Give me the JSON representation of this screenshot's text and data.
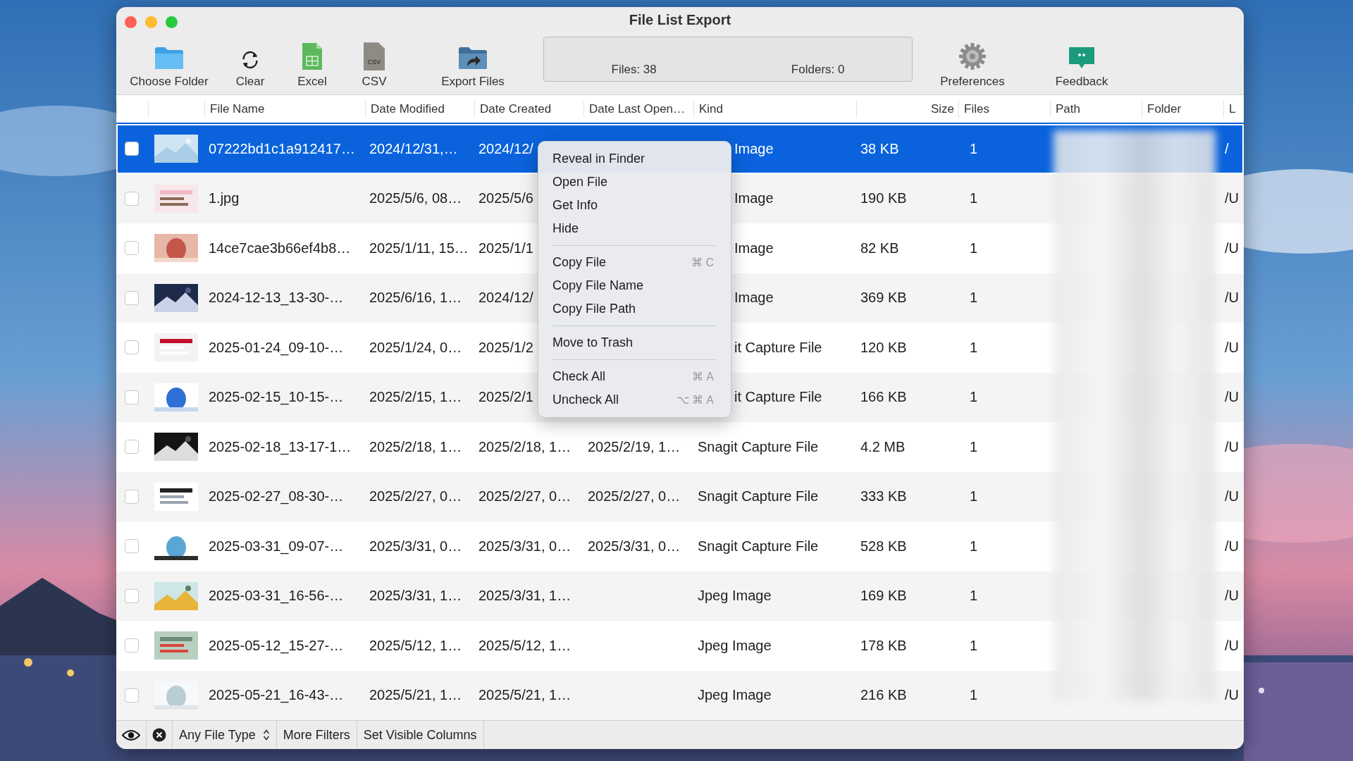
{
  "window": {
    "title": "File List Export"
  },
  "toolbar": [
    {
      "kind": "folder",
      "label": "Choose Folder"
    },
    {
      "kind": "refresh",
      "label": "Clear"
    },
    {
      "kind": "excel",
      "label": "Excel"
    },
    {
      "kind": "csv",
      "label": "CSV",
      "badge": "CSV"
    },
    {
      "kind": "export",
      "label": "Export Files"
    },
    {
      "kind": "stats",
      "files": "Files: 38",
      "folders": "Folders: 0"
    },
    {
      "kind": "gear",
      "label": "Preferences"
    },
    {
      "kind": "feedback",
      "label": "Feedback"
    }
  ],
  "table": {
    "columns": [
      "File Name",
      "Date Modified",
      "Date Created",
      "Date Last Open…",
      "Kind",
      "Size",
      "Files",
      "Path",
      "Folder",
      "L"
    ],
    "rows": [
      {
        "selected": true,
        "checked": false,
        "menu_over": true,
        "name": "07222bd1c1a912417…",
        "modified": "2024/12/31,…",
        "created": "2024/12/",
        "kind": "Image",
        "size": "38 KB",
        "files": "1",
        "column_last": "/"
      },
      {
        "selected": false,
        "checked": false,
        "menu_over": true,
        "name": "1.jpg",
        "modified": "2025/5/6, 08…",
        "created": "2025/5/6",
        "kind": "Image",
        "size": "190 KB",
        "files": "1",
        "column_last": "/U"
      },
      {
        "selected": false,
        "checked": false,
        "menu_over": true,
        "name": "14ce7cae3b66ef4b8…",
        "modified": "2025/1/11, 15…",
        "created": "2025/1/1",
        "kind": "Image",
        "size": "82 KB",
        "files": "1",
        "column_last": "/U"
      },
      {
        "selected": false,
        "checked": false,
        "menu_over": true,
        "name": "2024-12-13_13-30-…",
        "modified": "2025/6/16, 1…",
        "created": "2024/12/",
        "kind": "Image",
        "size": "369 KB",
        "files": "1",
        "column_last": "/U"
      },
      {
        "selected": false,
        "checked": false,
        "menu_over": true,
        "name": "2025-01-24_09-10-…",
        "modified": "2025/1/24, 0…",
        "created": "2025/1/2",
        "kind": "it Capture File",
        "size": "120 KB",
        "files": "1",
        "column_last": "/U"
      },
      {
        "selected": false,
        "checked": false,
        "menu_over": true,
        "name": "2025-02-15_10-15-…",
        "modified": "2025/2/15, 1…",
        "created": "2025/2/1",
        "kind": "it Capture File",
        "size": "166 KB",
        "files": "1",
        "column_last": "/U"
      },
      {
        "selected": false,
        "checked": false,
        "name": "2025-02-18_13-17-1…",
        "modified": "2025/2/18, 1…",
        "created": "2025/2/18, 1…",
        "last_opened": "2025/2/19, 1…",
        "kind": "Snagit Capture File",
        "size": "4.2 MB",
        "files": "1",
        "column_last": "/U"
      },
      {
        "selected": false,
        "checked": false,
        "name": "2025-02-27_08-30-…",
        "modified": "2025/2/27, 0…",
        "created": "2025/2/27, 0…",
        "last_opened": "2025/2/27, 0…",
        "kind": "Snagit Capture File",
        "size": "333 KB",
        "files": "1",
        "column_last": "/U"
      },
      {
        "selected": false,
        "checked": false,
        "name": "2025-03-31_09-07-…",
        "modified": "2025/3/31, 0…",
        "created": "2025/3/31, 0…",
        "last_opened": "2025/3/31, 0…",
        "kind": "Snagit Capture File",
        "size": "528 KB",
        "files": "1",
        "column_last": "/U"
      },
      {
        "selected": false,
        "checked": false,
        "name": "2025-03-31_16-56-…",
        "modified": "2025/3/31, 1…",
        "created": "2025/3/31, 1…",
        "kind": "Jpeg Image",
        "size": "169 KB",
        "files": "1",
        "column_last": "/U"
      },
      {
        "selected": false,
        "checked": false,
        "name": "2025-05-12_15-27-…",
        "modified": "2025/5/12, 1…",
        "created": "2025/5/12, 1…",
        "kind": "Jpeg Image",
        "size": "178 KB",
        "files": "1",
        "column_last": "/U"
      },
      {
        "selected": false,
        "checked": false,
        "name": "2025-05-21_16-43-…",
        "modified": "2025/5/21, 1…",
        "created": "2025/5/21, 1…",
        "kind": "Jpeg Image",
        "size": "216 KB",
        "files": "1",
        "column_last": "/U"
      }
    ]
  },
  "context_menu": {
    "groups": [
      [
        {
          "label": "Reveal in Finder"
        },
        {
          "label": "Open File"
        },
        {
          "label": "Get Info"
        },
        {
          "label": "Hide"
        }
      ],
      [
        {
          "label": "Copy File",
          "shortcut": "⌘C"
        },
        {
          "label": "Copy File Name"
        },
        {
          "label": "Copy File Path"
        }
      ],
      [
        {
          "label": "Move to Trash"
        }
      ],
      [
        {
          "label": "Check All",
          "shortcut": "⌘A"
        },
        {
          "label": "Uncheck All",
          "shortcut": "⌥⌘A"
        }
      ]
    ]
  },
  "bottom_bar": {
    "file_type": "Any File Type",
    "buttons": [
      "More Filters",
      "Set Visible Columns"
    ]
  }
}
